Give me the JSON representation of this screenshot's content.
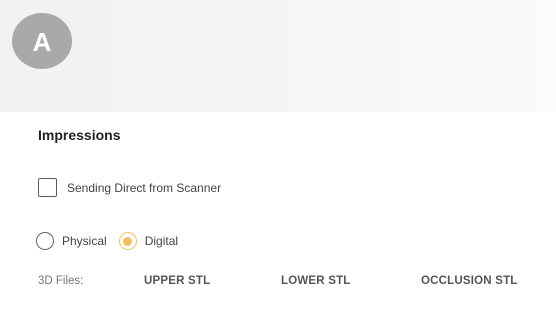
{
  "step": {
    "letter": "A"
  },
  "impressions": {
    "title": "Impressions",
    "direct_scanner_label": "Sending Direct from Scanner",
    "impression_type": {
      "options": [
        "Physical",
        "Digital"
      ],
      "selected": "Digital"
    },
    "files": {
      "label": "3D Files:",
      "upper": "UPPER STL",
      "lower": "LOWER STL",
      "occlusion": "OCCLUSION STL"
    }
  },
  "colors": {
    "badge": "#a9a9a9",
    "radio_selected": "#f1c065"
  }
}
